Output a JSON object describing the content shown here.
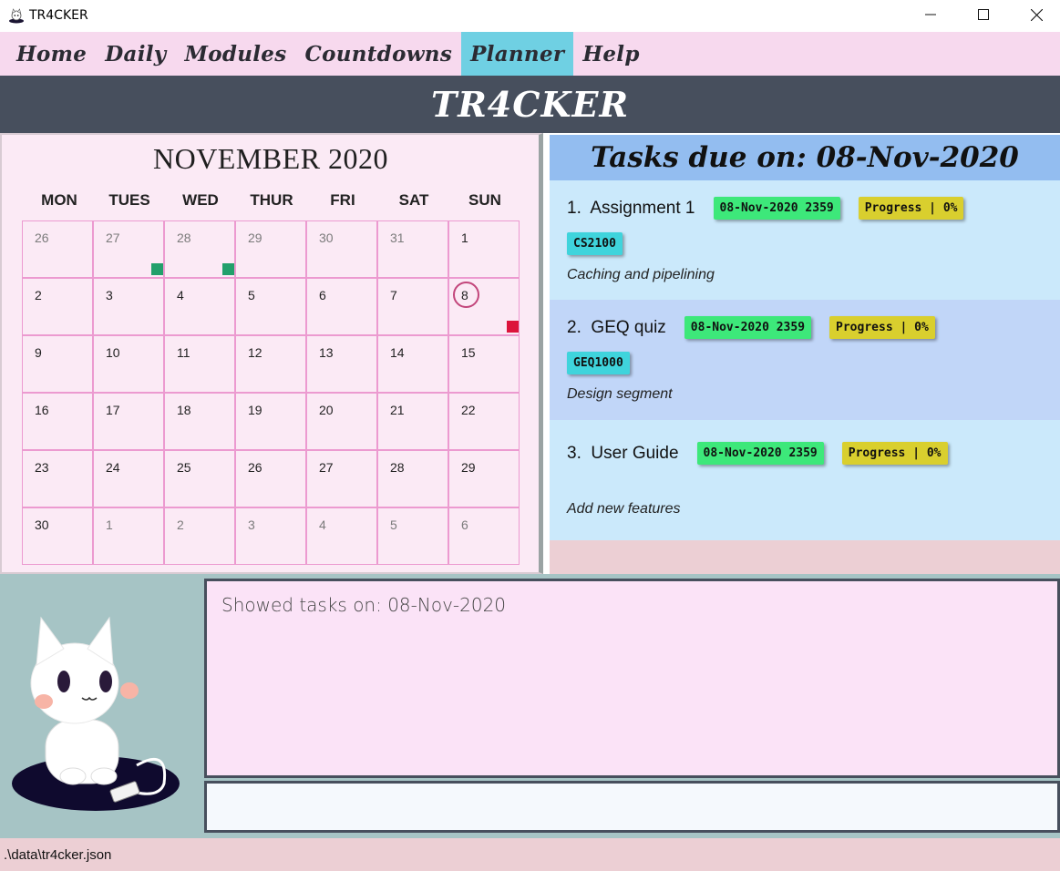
{
  "window": {
    "title": "TR4CKER",
    "icon": "app-mascot-icon"
  },
  "menu": {
    "items": [
      {
        "label": "Home"
      },
      {
        "label": "Daily"
      },
      {
        "label": "Modules"
      },
      {
        "label": "Countdowns"
      },
      {
        "label": "Planner",
        "active": true
      },
      {
        "label": "Help"
      }
    ]
  },
  "header": {
    "title": "TR4CKER"
  },
  "calendar": {
    "title": "NOVEMBER 2020",
    "days_of_week": [
      "MON",
      "TUES",
      "WED",
      "THUR",
      "FRI",
      "SAT",
      "SUN"
    ],
    "weeks": [
      [
        "26",
        "27",
        "28",
        "29",
        "30",
        "31",
        "1"
      ],
      [
        "2",
        "3",
        "4",
        "5",
        "6",
        "7",
        "8"
      ],
      [
        "9",
        "10",
        "11",
        "12",
        "13",
        "14",
        "15"
      ],
      [
        "16",
        "17",
        "18",
        "19",
        "20",
        "21",
        "22"
      ],
      [
        "23",
        "24",
        "25",
        "26",
        "27",
        "28",
        "29"
      ],
      [
        "30",
        "1",
        "2",
        "3",
        "4",
        "5",
        "6"
      ]
    ],
    "selected_day": "8",
    "marker_colors": {
      "green": "#22a06b",
      "red": "#dc143c"
    }
  },
  "tasks": {
    "header": "Tasks due on: 08-Nov-2020",
    "items": [
      {
        "number": "1.",
        "title": "Assignment 1",
        "deadline": "08-Nov-2020 2359",
        "progress": "Progress | 0%",
        "module": "CS2100",
        "description": "Caching and pipelining"
      },
      {
        "number": "2.",
        "title": "GEQ quiz",
        "deadline": "08-Nov-2020 2359",
        "progress": "Progress | 0%",
        "module": "GEQ1000",
        "description": "Design segment"
      },
      {
        "number": "3.",
        "title": "User Guide",
        "deadline": "08-Nov-2020 2359",
        "progress": "Progress | 0%",
        "module": "",
        "description": "Add new features"
      }
    ]
  },
  "result": {
    "text": "Showed tasks on: 08-Nov-2020"
  },
  "command": {
    "value": "",
    "placeholder": ""
  },
  "status": {
    "path": ".\\data\\tr4cker.json"
  }
}
